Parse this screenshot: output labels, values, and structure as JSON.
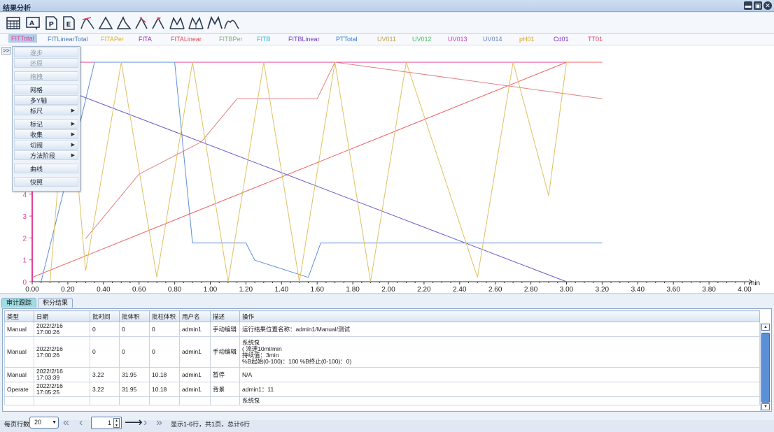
{
  "window": {
    "title": "结果分析"
  },
  "toolbar": {
    "icons": [
      "table-icon",
      "text-a-icon",
      "p-icon",
      "e-icon",
      "peak-pick-icon",
      "peak-outline-icon",
      "peak-outline-icon",
      "peak-split-icon",
      "peak-mark-icon",
      "multi-peak-icon",
      "multi-peak-icon",
      "multi-peak-icon",
      "peak-shape-icon"
    ]
  },
  "series": [
    {
      "label": "FITTotal",
      "color": "#e0409a",
      "active": true
    },
    {
      "label": "FITLinearTotal",
      "color": "#4a7fc0"
    },
    {
      "label": "FITAPer",
      "color": "#e0b030"
    },
    {
      "label": "FITA",
      "color": "#a020c0"
    },
    {
      "label": "FITALinear",
      "color": "#e05050"
    },
    {
      "label": "FITBPer",
      "color": "#80b080"
    },
    {
      "label": "FITB",
      "color": "#20c0e0"
    },
    {
      "label": "FITBLinear",
      "color": "#7040c0"
    },
    {
      "label": "PTTotal",
      "color": "#3080e0"
    },
    {
      "label": "UV011",
      "color": "#c0a040"
    },
    {
      "label": "UV012",
      "color": "#40c060"
    },
    {
      "label": "UV013",
      "color": "#c040c0"
    },
    {
      "label": "UV014",
      "color": "#6080c0"
    },
    {
      "label": "pH01",
      "color": "#d4a020"
    },
    {
      "label": "Cd01",
      "color": "#8030c0"
    },
    {
      "label": "TT01",
      "color": "#e04060"
    }
  ],
  "context_menu": {
    "toggle_label": ">>",
    "items": [
      {
        "label": "逐步",
        "disabled": true
      },
      {
        "label": "还原",
        "disabled": true
      },
      {
        "label": "拖拽",
        "disabled": true
      },
      {
        "label": "网格"
      },
      {
        "label": "多Y轴"
      },
      {
        "label": "标尺",
        "submenu": true
      },
      {
        "label": "标记",
        "submenu": true
      },
      {
        "label": "收集",
        "submenu": true
      },
      {
        "label": "切阀",
        "submenu": true
      },
      {
        "label": "方法阶段",
        "submenu": true
      },
      {
        "label": "曲线"
      },
      {
        "label": "快照"
      }
    ]
  },
  "chart": {
    "x_unit": "min",
    "x_ticks": [
      "0.00",
      "0.20",
      "0.40",
      "0.60",
      "0.80",
      "1.00",
      "1.20",
      "1.40",
      "1.60",
      "1.80",
      "2.00",
      "2.20",
      "2.40",
      "2.60",
      "2.80",
      "3.00",
      "3.20",
      "3.40",
      "3.60",
      "3.80",
      "4.00"
    ],
    "y_ticks": [
      "0",
      "1",
      "2",
      "3",
      "4"
    ]
  },
  "chart_data": {
    "type": "line",
    "xlabel": "min",
    "xlim": [
      0,
      4.0
    ],
    "ylim": [
      0,
      10.2
    ],
    "series": [
      {
        "color": "#e0409a",
        "points": [
          [
            0.0,
            10.2
          ],
          [
            3.2,
            10.2
          ]
        ]
      },
      {
        "color": "#f06060",
        "points": [
          [
            0.0,
            0.2
          ],
          [
            3.0,
            10.2
          ],
          [
            3.2,
            10.2
          ]
        ]
      },
      {
        "color": "#6a5acd",
        "points": [
          [
            0.0,
            9.5
          ],
          [
            3.0,
            0.0
          ]
        ]
      },
      {
        "color": "#e08080",
        "points": [
          [
            0.3,
            2.0
          ],
          [
            0.6,
            5.0
          ],
          [
            0.95,
            6.5
          ],
          [
            1.15,
            8.5
          ],
          [
            1.6,
            8.5
          ],
          [
            1.7,
            10.2
          ],
          [
            3.2,
            8.5
          ]
        ]
      },
      {
        "color": "#5b8fd8",
        "points": [
          [
            0.05,
            0.0
          ],
          [
            0.2,
            5.0
          ],
          [
            0.35,
            10.2
          ],
          [
            0.8,
            10.2
          ],
          [
            0.9,
            1.8
          ],
          [
            1.2,
            1.8
          ],
          [
            1.25,
            1.0
          ],
          [
            1.55,
            0.2
          ],
          [
            1.62,
            1.8
          ],
          [
            3.2,
            1.8
          ]
        ]
      },
      {
        "color": "#e0c060",
        "points": [
          [
            0.1,
            0.0
          ],
          [
            0.2,
            10.2
          ],
          [
            0.3,
            0.5
          ],
          [
            0.5,
            10.2
          ],
          [
            0.7,
            0.2
          ],
          [
            0.9,
            10.2
          ],
          [
            1.1,
            0.0
          ],
          [
            1.3,
            10.2
          ],
          [
            1.5,
            0.0
          ],
          [
            1.7,
            10.2
          ],
          [
            1.9,
            0.0
          ],
          [
            2.1,
            10.2
          ],
          [
            2.5,
            0.2
          ],
          [
            2.7,
            10.2
          ],
          [
            2.9,
            4.0
          ],
          [
            3.0,
            10.2
          ]
        ]
      }
    ]
  },
  "bottom": {
    "tabs": [
      {
        "label": "审计跟踪",
        "active": true
      },
      {
        "label": "积分结果"
      }
    ],
    "columns": [
      "类型",
      "日期",
      "批时间",
      "批体积",
      "批柱体积",
      "用户名",
      "描述",
      "操作"
    ],
    "rows": [
      {
        "type": "Manual",
        "date": "2022/2/16 17:00:26",
        "batch_time": "0",
        "batch_vol": "0",
        "column_vol": "0",
        "user": "admin1",
        "desc": "手动编辑",
        "op_lines": [
          "运行结果位置名称：admin1/Manual/测试"
        ]
      },
      {
        "type": "Manual",
        "date": "2022/2/16 17:00:26",
        "batch_time": "0",
        "batch_vol": "0",
        "column_vol": "0",
        "user": "admin1",
        "desc": "手动编辑",
        "op_lines": [
          "系统泵",
          "( 流速10ml/min",
          "持续值：3min",
          "%B起始(0-100)：100 %B终止(0-100)：0)"
        ]
      },
      {
        "type": "Manual",
        "date": "2022/2/16 17:03:39",
        "batch_time": "3.22",
        "batch_vol": "31.95",
        "column_vol": "10.18",
        "user": "admin1",
        "desc": "暂停",
        "op_lines": [
          "N/A"
        ]
      },
      {
        "type": "Operate",
        "date": "2022/2/16 17:05:25",
        "batch_time": "3.22",
        "batch_vol": "31.95",
        "column_vol": "10.18",
        "user": "admin1",
        "desc": "背景",
        "op_lines": [
          "admin1：11"
        ]
      },
      {
        "type": "",
        "date": "",
        "batch_time": "",
        "batch_vol": "",
        "column_vol": "",
        "user": "",
        "desc": "",
        "op_lines": [
          "系统泵"
        ]
      }
    ],
    "pager": {
      "rows_per_page_label": "每页行数",
      "rows_per_page": "20",
      "current_page": "1",
      "summary": "显示1-6行，共1页，总计6行"
    }
  }
}
